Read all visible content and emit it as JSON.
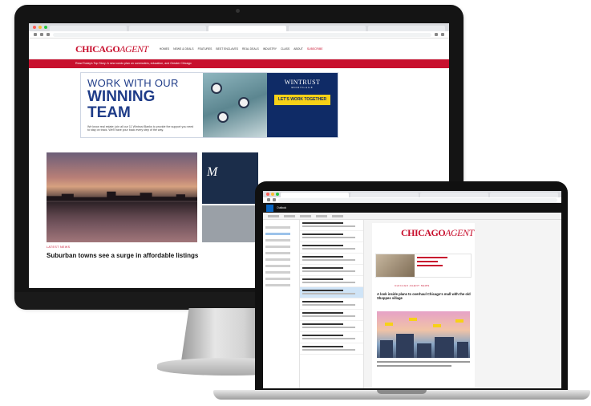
{
  "site": {
    "logo_part1": "CHICAGO",
    "logo_part2": "AGENT",
    "nav": [
      "HOMES",
      "NEWS & DEALS",
      "FEATURES",
      "BEST ENCLAVES",
      "REAL DEALS",
      "INDUSTRY",
      "CLASS",
      "ABOUT",
      "SUBSCRIBE"
    ],
    "banner": "Read Today's Top Story: A new condo plan on commuters, education, and Greater Chicago"
  },
  "ad": {
    "line1": "WORK WITH OUR",
    "line2": "WINNING TEAM",
    "copy": "We know real estate: join all our 11 Wintrust Banks to provide the support you need to stay on track. We'll have your back every step of the way.",
    "brand": "WINTRUST",
    "brand_sub": "MORTGAGE",
    "cta": "LET'S WORK TOGETHER"
  },
  "hero": {
    "section_label": "LATEST NEWS",
    "headline": "Suburban towns see a surge in affordable listings"
  },
  "mail": {
    "title": "Outlook",
    "newsletter_section": "CHICAGO AGENT NEWS",
    "newsletter_headline": "A look inside plans to overhaul Chicago's mall with the old Shoppes village"
  },
  "colors": {
    "brand_red": "#c8102e",
    "brand_navy": "#0f2b66",
    "cta_yellow": "#f7d117"
  }
}
